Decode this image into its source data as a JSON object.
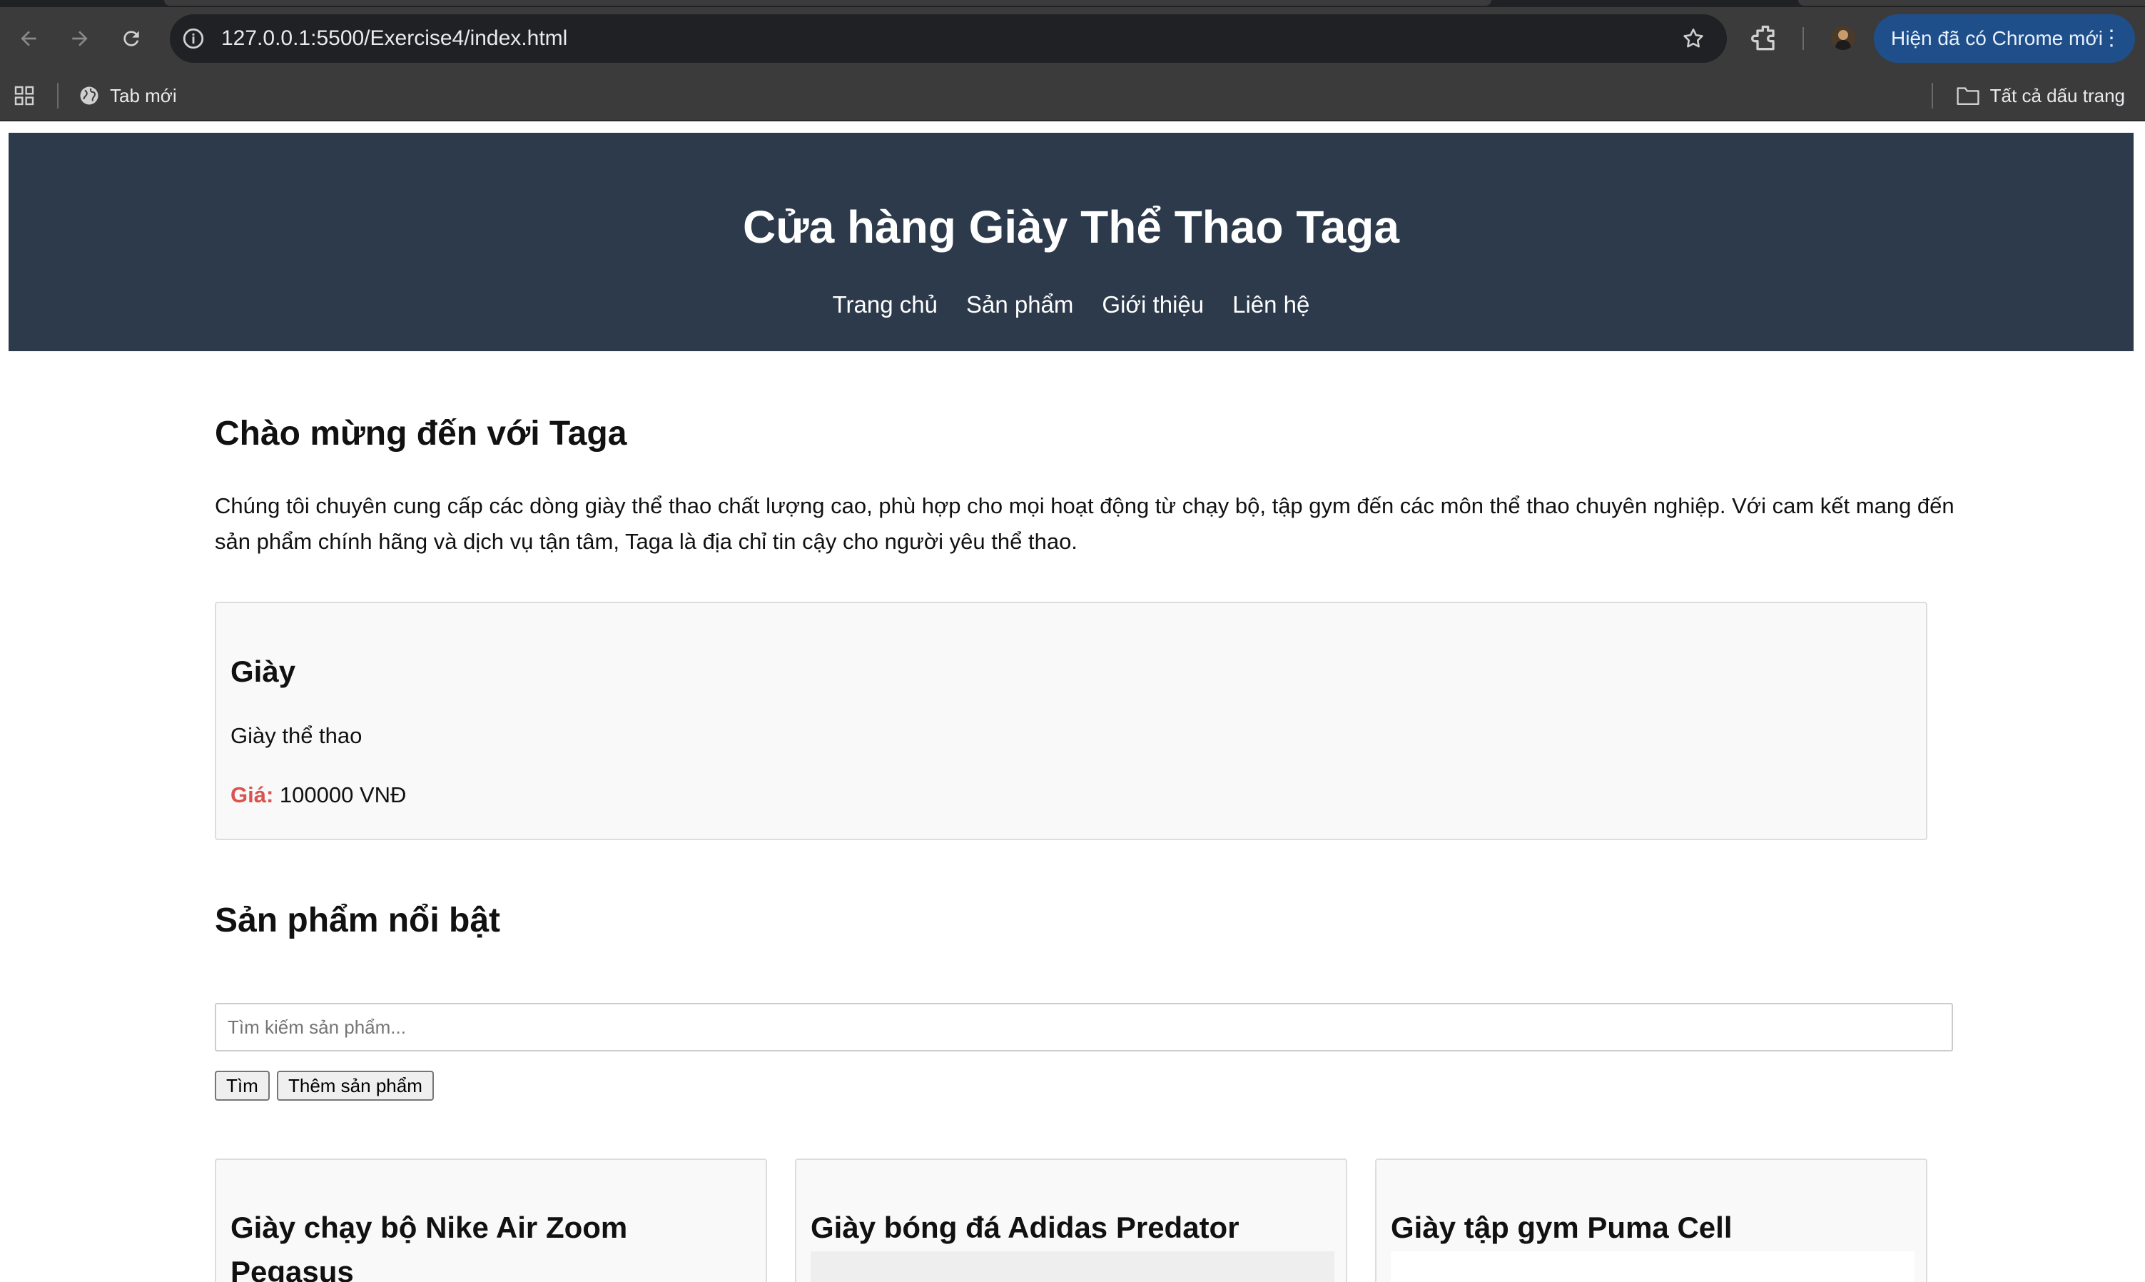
{
  "browser": {
    "url": "127.0.0.1:5500/Exercise4/index.html",
    "update_label": "Hiện đã có Chrome mới",
    "bookmarks": {
      "new_tab": "Tab mới",
      "all_bookmarks": "Tất cả dấu trang"
    }
  },
  "header": {
    "title": "Cửa hàng Giày Thể Thao Taga",
    "nav": [
      "Trang chủ",
      "Sản phẩm",
      "Giới thiệu",
      "Liên hệ"
    ]
  },
  "welcome": {
    "title": "Chào mừng đến với Taga",
    "text": "Chúng tôi chuyên cung cấp các dòng giày thể thao chất lượng cao, phù hợp cho mọi hoạt động từ chạy bộ, tập gym đến các môn thể thao chuyên nghiệp. Với cam kết mang đến sản phẩm chính hãng và dịch vụ tận tâm, Taga là địa chỉ tin cậy cho người yêu thể thao."
  },
  "product": {
    "name": "Giày",
    "description": "Giày thể thao",
    "price_label": "Giá:",
    "price_value": " 100000 VNĐ"
  },
  "featured": {
    "title": "Sản phẩm nổi bật",
    "search_placeholder": "Tìm kiếm sản phẩm...",
    "search_button": "Tìm",
    "add_button": "Thêm sản phẩm",
    "cards": [
      {
        "name": "Giày chạy bộ Nike Air Zoom Pegasus"
      },
      {
        "name": "Giày bóng đá Adidas Predator"
      },
      {
        "name": "Giày tập gym Puma Cell"
      }
    ]
  },
  "colors": {
    "header_bg": "#2c3a4b",
    "price_label": "#d9534f",
    "update_pill": "#1f4f8a"
  }
}
